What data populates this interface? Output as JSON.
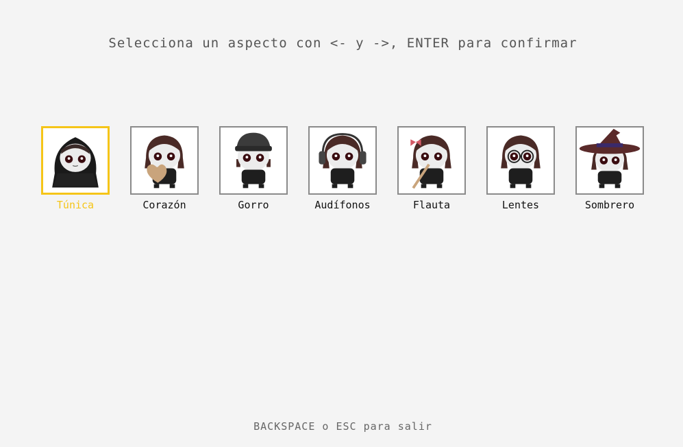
{
  "instructions": "Selecciona un aspecto con <- y ->, ENTER para confirmar",
  "footer": "BACKSPACE o ESC para salir",
  "colors": {
    "background": "#f4f4f4",
    "selected": "#f5c518",
    "border": "#8a8a8a"
  },
  "skins": [
    {
      "label": "Túnica",
      "icon": "hooded-cloak-character-icon",
      "selected": true
    },
    {
      "label": "Corazón",
      "icon": "heart-holding-character-icon",
      "selected": false
    },
    {
      "label": "Gorro",
      "icon": "beanie-character-icon",
      "selected": false
    },
    {
      "label": "Audífonos",
      "icon": "headphones-character-icon",
      "selected": false
    },
    {
      "label": "Flauta",
      "icon": "flute-character-icon",
      "selected": false
    },
    {
      "label": "Lentes",
      "icon": "glasses-character-icon",
      "selected": false
    },
    {
      "label": "Sombrero",
      "icon": "witch-hat-character-icon",
      "selected": false
    }
  ]
}
